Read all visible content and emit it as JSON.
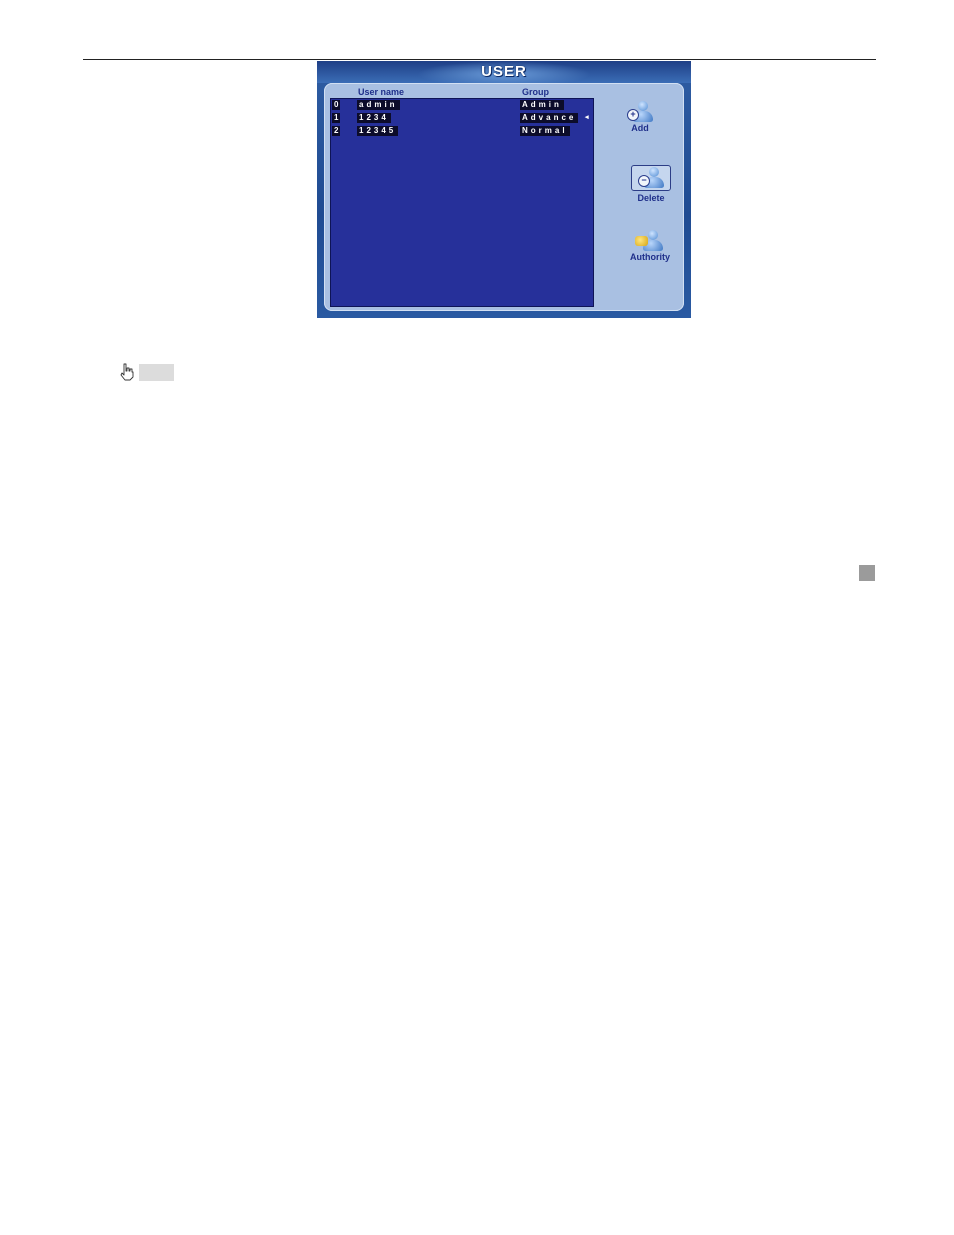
{
  "window": {
    "title": "USER"
  },
  "user_list": {
    "columns": [
      "User name",
      "Group"
    ],
    "rows": [
      {
        "index": "0",
        "name": "admin",
        "group": "Admin",
        "arrow": ""
      },
      {
        "index": "1",
        "name": "1234",
        "group": "Advance",
        "arrow": "◂"
      },
      {
        "index": "2",
        "name": "12345",
        "group": "Normal",
        "arrow": ""
      }
    ]
  },
  "actions": {
    "add_label": "Add",
    "delete_label": "Delete",
    "authority_label": "Authority"
  },
  "icons": {
    "add": "add-user-icon",
    "delete": "delete-user-icon",
    "authority": "authority-key-icon",
    "cursor": "hand-pointer-icon"
  },
  "colors": {
    "list_background": "#26309a",
    "panel_background": "#a9c0e2",
    "label_text": "#1f2f8a"
  }
}
